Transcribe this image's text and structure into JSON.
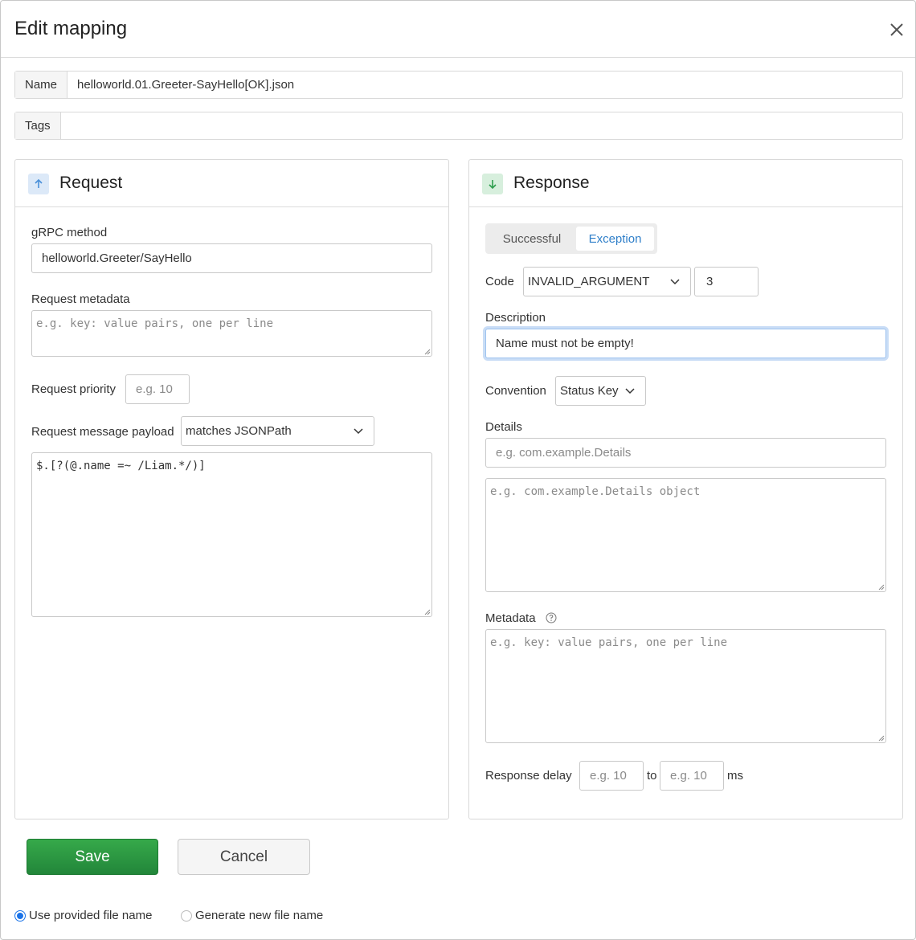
{
  "dialog": {
    "title": "Edit mapping",
    "close_icon": "close-icon"
  },
  "name_field": {
    "label": "Name",
    "value": "helloworld.01.Greeter-SayHello[OK].json"
  },
  "tags_field": {
    "label": "Tags",
    "value": ""
  },
  "request": {
    "title": "Request",
    "icon": "arrow-up-icon",
    "icon_color": "#4a90d9",
    "grpc_method": {
      "label": "gRPC method",
      "value": "helloworld.Greeter/SayHello"
    },
    "metadata": {
      "label": "Request metadata",
      "placeholder": "e.g. key: value pairs, one per line"
    },
    "priority": {
      "label": "Request priority",
      "placeholder": "e.g. 10"
    },
    "payload": {
      "label": "Request message payload",
      "matcher": "matches JSONPath",
      "value": "$.[?(@.name =~ /Liam.*/)]"
    }
  },
  "response": {
    "title": "Response",
    "icon": "arrow-down-icon",
    "icon_color": "#2e9e4e",
    "tabs": [
      {
        "label": "Successful",
        "active": false
      },
      {
        "label": "Exception",
        "active": true
      }
    ],
    "code": {
      "label": "Code",
      "selected": "INVALID_ARGUMENT",
      "number": "3"
    },
    "description": {
      "label": "Description",
      "value": "Name must not be empty!"
    },
    "convention": {
      "label": "Convention",
      "selected": "Status Key"
    },
    "details": {
      "label": "Details",
      "type_placeholder": "e.g. com.example.Details",
      "object_placeholder": "e.g. com.example.Details object"
    },
    "metadata": {
      "label": "Metadata",
      "placeholder": "e.g. key: value pairs, one per line"
    },
    "delay": {
      "label": "Response delay",
      "from_placeholder": "e.g. 10",
      "to_label": "to",
      "to_placeholder": "e.g. 10",
      "unit": "ms"
    }
  },
  "actions": {
    "save": "Save",
    "cancel": "Cancel"
  },
  "file_name_options": [
    {
      "label": "Use provided file name",
      "checked": true
    },
    {
      "label": "Generate new file name",
      "checked": false
    }
  ],
  "colors": {
    "accent": "#2f7fc9",
    "save": "#28a745",
    "focus": "#9ec3ef"
  }
}
